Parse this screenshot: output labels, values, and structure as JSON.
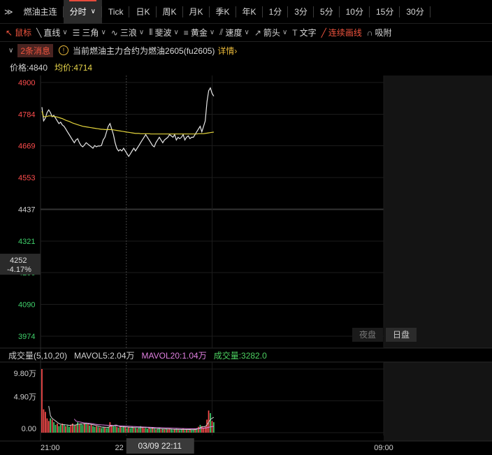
{
  "tabs": [
    {
      "label": "≫",
      "icon": "double-chevron-icon"
    },
    {
      "label": "燃油主连"
    },
    {
      "label": "分时",
      "active": true,
      "caret": true
    },
    {
      "label": "Tick"
    },
    {
      "label": "日K"
    },
    {
      "label": "周K"
    },
    {
      "label": "月K"
    },
    {
      "label": "季K"
    },
    {
      "label": "年K"
    },
    {
      "label": "1分"
    },
    {
      "label": "3分"
    },
    {
      "label": "5分"
    },
    {
      "label": "10分"
    },
    {
      "label": "15分"
    },
    {
      "label": "30分"
    }
  ],
  "tools": [
    {
      "icon": "cursor-icon",
      "glyph": "↖",
      "label": "鼠标",
      "red": true
    },
    {
      "icon": "line-icon",
      "glyph": "╲",
      "label": "直线",
      "dd": true
    },
    {
      "icon": "triangle-icon",
      "glyph": "☰",
      "label": "三角",
      "dd": true
    },
    {
      "icon": "wave-icon",
      "glyph": "∿",
      "label": "三浪",
      "dd": true
    },
    {
      "icon": "fib-icon",
      "glyph": "⦀",
      "label": "斐波",
      "dd": true
    },
    {
      "icon": "gold-icon",
      "glyph": "≡",
      "label": "黄金",
      "dd": true
    },
    {
      "icon": "speed-icon",
      "glyph": "⫽",
      "label": "速度",
      "dd": true
    },
    {
      "icon": "arrow-icon",
      "glyph": "↗",
      "label": "箭头",
      "dd": true
    },
    {
      "icon": "text-icon",
      "glyph": "T",
      "label": "文字"
    },
    {
      "icon": "pen-icon",
      "glyph": "╱",
      "label": "连续画线",
      "red": true
    },
    {
      "icon": "magnet-icon",
      "glyph": "∩",
      "label": "吸附"
    }
  ],
  "notice": {
    "badge": "2条消息",
    "text": "当前燃油主力合约为燃油2605(fu2605)",
    "detail": "详情›"
  },
  "info": {
    "price_label": "价格:4840",
    "avg_label": "均价:4714"
  },
  "colors": {
    "up": "#ff4d4d",
    "down": "#3fcf6a",
    "flat": "#d0d0d0",
    "price": "#e8e8e8",
    "avg": "#e3d43c",
    "ma5": "#d0d0d0",
    "ma20": "#e080e0",
    "vol_label": "#4cd060"
  },
  "chart_data": [
    {
      "type": "line",
      "y_ticks": [
        {
          "v": 4900,
          "label": "4900",
          "tone": "up"
        },
        {
          "v": 4784,
          "label": "4784",
          "tone": "up"
        },
        {
          "v": 4669,
          "label": "4669",
          "tone": "up"
        },
        {
          "v": 4553,
          "label": "4553",
          "tone": "up"
        },
        {
          "v": 4437,
          "label": "4437",
          "tone": "flat"
        },
        {
          "v": 4321,
          "label": "4321",
          "tone": "down"
        },
        {
          "v": 4206,
          "label": "4206",
          "tone": "down"
        },
        {
          "v": 4090,
          "label": "4090",
          "tone": "down"
        },
        {
          "v": 3974,
          "label": "3974",
          "tone": "down"
        }
      ],
      "ylim": [
        3974,
        4900
      ],
      "baseline": 4437,
      "cursor": {
        "price": "4252",
        "pct": "-4.17%",
        "value": 4252
      },
      "session_labels": [
        "夜盘",
        "日盘"
      ],
      "series": [
        {
          "key": "price",
          "values": [
            4810,
            4760,
            4770,
            4790,
            4800,
            4790,
            4775,
            4780,
            4770,
            4760,
            4750,
            4755,
            4745,
            4740,
            4730,
            4720,
            4710,
            4700,
            4690,
            4680,
            4690,
            4695,
            4680,
            4670,
            4665,
            4672,
            4680,
            4675,
            4670,
            4665,
            4660,
            4670,
            4665,
            4668,
            4668,
            4670,
            4690,
            4700,
            4720,
            4740,
            4750,
            4730,
            4710,
            4680,
            4660,
            4650,
            4655,
            4650,
            4660,
            4650,
            4640,
            4630,
            4640,
            4650,
            4660,
            4650,
            4660,
            4670,
            4680,
            4690,
            4700,
            4710,
            4700,
            4690,
            4680,
            4670,
            4665,
            4680,
            4690,
            4700,
            4690,
            4680,
            4690,
            4695,
            4700,
            4710,
            4705,
            4700,
            4710,
            4690,
            4700,
            4695,
            4700,
            4710,
            4690,
            4700,
            4705,
            4695,
            4700,
            4700,
            4710,
            4720,
            4730,
            4740,
            4720,
            4740,
            4760,
            4830,
            4870,
            4880,
            4860,
            4850
          ]
        },
        {
          "key": "avg",
          "values": [
            4795,
            4775,
            4775,
            4776,
            4778,
            4778,
            4777,
            4776,
            4775,
            4774,
            4772,
            4770,
            4768,
            4765,
            4762,
            4760,
            4758,
            4755,
            4752,
            4750,
            4748,
            4746,
            4744,
            4742,
            4740,
            4739,
            4738,
            4737,
            4736,
            4735,
            4734,
            4733,
            4732,
            4731,
            4730,
            4729,
            4729,
            4728,
            4728,
            4728,
            4728,
            4728,
            4727,
            4726,
            4725,
            4724,
            4723,
            4722,
            4721,
            4720,
            4719,
            4718,
            4717,
            4716,
            4715,
            4714,
            4714,
            4714,
            4713,
            4713,
            4713,
            4713,
            4713,
            4713,
            4712,
            4712,
            4712,
            4712,
            4712,
            4712,
            4712,
            4712,
            4712,
            4712,
            4712,
            4712,
            4712,
            4712,
            4712,
            4712,
            4712,
            4712,
            4712,
            4712,
            4712,
            4712,
            4712,
            4712,
            4712,
            4712,
            4712,
            4712,
            4713,
            4713,
            4713,
            4713,
            4714,
            4715,
            4716,
            4717,
            4718,
            4719
          ]
        }
      ]
    },
    {
      "type": "bar",
      "legend": [
        {
          "label": "成交量(5,10,20)",
          "tone": "flat"
        },
        {
          "label": "MAVOL5:2.04万",
          "tone": "flat"
        },
        {
          "label": "MAVOL20:1.04万",
          "tone": "ma20"
        },
        {
          "label": "成交量:3282.0",
          "tone": "vol"
        }
      ],
      "y_ticks": [
        {
          "v": 98000,
          "label": "9.80万"
        },
        {
          "v": 49000,
          "label": "4.90万"
        },
        {
          "v": 0,
          "label": "0.00"
        }
      ],
      "ylim": [
        0,
        98000
      ],
      "x_labels": [
        {
          "label": "21:00"
        },
        {
          "label": "22"
        },
        {
          "label": "09:00"
        }
      ],
      "cursor_time": "03/09 22:11",
      "values": [
        98000,
        36000,
        32000,
        22000,
        18000,
        22000,
        20000,
        16000,
        12000,
        14000,
        10000,
        12000,
        14000,
        12000,
        10000,
        11000,
        9000,
        12000,
        14000,
        11000,
        12000,
        16000,
        13000,
        14000,
        12000,
        14000,
        15000,
        13000,
        11000,
        12000,
        10000,
        9000,
        10000,
        9000,
        8000,
        7000,
        9000,
        8000,
        7000,
        9000,
        16000,
        12000,
        11000,
        10000,
        9000,
        8000,
        9000,
        8000,
        10000,
        9000,
        7000,
        8000,
        7000,
        9000,
        8000,
        7000,
        6000,
        8000,
        10000,
        9000,
        7000,
        8000,
        6000,
        7000,
        6000,
        8000,
        6000,
        5000,
        6000,
        7000,
        5000,
        6000,
        5000,
        6000,
        5000,
        6000,
        5000,
        4000,
        5000,
        6000,
        5000,
        4000,
        5000,
        6000,
        4000,
        5000,
        4000,
        5000,
        4000,
        5000,
        6000,
        7000,
        9000,
        12000,
        10000,
        8000,
        9000,
        20000,
        34000,
        30000,
        18000,
        16000
      ],
      "dirs": "UUUUUDUDDUDDUDUDDUUDUDUDDUDUDUDDUDUDDUDDUUDDUDUDDUDUDDUDUDDUUDDUDUDUDDUDUDUUDDUDUDDUDUDUDDUDUDUUUUUDU",
      "ma5": [
        null,
        null,
        null,
        null,
        41000,
        26000,
        22000,
        20000,
        18000,
        16000,
        14000,
        13000,
        12500,
        12400,
        12000,
        11800,
        11200,
        11600,
        12100,
        11600,
        11800,
        13000,
        13200,
        13600,
        13400,
        13800,
        14200,
        13800,
        13000,
        12600,
        12200,
        11600,
        11000,
        10200,
        9600,
        8600,
        8600,
        8400,
        8200,
        8200,
        9800,
        10400,
        10800,
        11600,
        11600,
        10000,
        9400,
        8800,
        8800,
        8800,
        8600,
        8400,
        8200,
        8200,
        7800,
        7800,
        7600,
        7600,
        7800,
        8000,
        8000,
        8400,
        8000,
        7400,
        6800,
        7000,
        6600,
        6400,
        6200,
        6400,
        6000,
        5800,
        5800,
        5800,
        5600,
        5600,
        5400,
        5200,
        5200,
        5200,
        5200,
        5000,
        5000,
        5200,
        4800,
        4800,
        4800,
        4800,
        4600,
        4600,
        4800,
        5400,
        6200,
        7800,
        8800,
        9200,
        9600,
        11800,
        16200,
        20200,
        22200,
        23600
      ],
      "ma20": [
        null,
        null,
        null,
        null,
        null,
        null,
        null,
        null,
        null,
        null,
        null,
        null,
        null,
        null,
        null,
        null,
        null,
        null,
        null,
        21000,
        17800,
        17000,
        16400,
        16000,
        15500,
        15000,
        14800,
        14500,
        14200,
        14000,
        13600,
        13000,
        12700,
        12400,
        12200,
        12000,
        11800,
        11600,
        11400,
        11200,
        11400,
        11200,
        11000,
        10800,
        10600,
        10500,
        10300,
        10200,
        10100,
        10000,
        9900,
        9800,
        9700,
        9600,
        9500,
        9400,
        9200,
        9000,
        8800,
        8700,
        8600,
        8500,
        8400,
        8300,
        8200,
        8100,
        8000,
        7900,
        7800,
        7700,
        7600,
        7500,
        7400,
        7300,
        7200,
        7100,
        7000,
        6900,
        6800,
        6700,
        6600,
        6500,
        6400,
        6300,
        6200,
        6100,
        6000,
        5900,
        5900,
        5900,
        6000,
        6100,
        6300,
        6500,
        6700,
        6900,
        7100,
        7500,
        8200,
        8800,
        9300,
        9800
      ]
    }
  ]
}
